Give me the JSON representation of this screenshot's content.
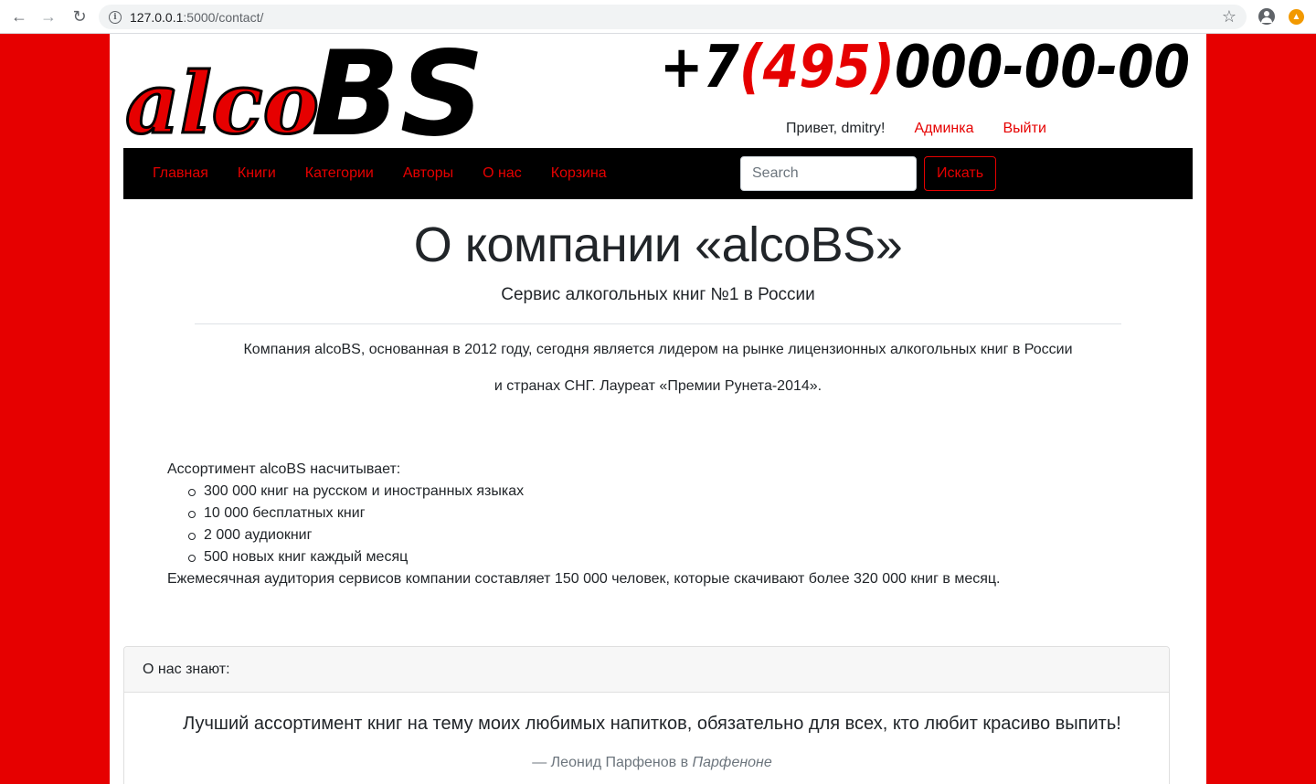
{
  "browser": {
    "url_host": "127.0.0.1",
    "url_path": ":5000/contact/"
  },
  "header": {
    "logo_left": "alco",
    "logo_right": "BS",
    "phone_prefix": "+7",
    "phone_code": "(495)",
    "phone_number": "000-00-00",
    "greeting": "Привет, dmitry!",
    "admin_link": "Админка",
    "logout_link": "Выйти"
  },
  "nav": {
    "items": [
      {
        "label": "Главная"
      },
      {
        "label": "Книги"
      },
      {
        "label": "Категории"
      },
      {
        "label": "Авторы"
      },
      {
        "label": "О нас"
      },
      {
        "label": "Корзина"
      }
    ],
    "search_placeholder": "Search",
    "search_button": "Искать"
  },
  "main": {
    "title": "О компании «alcoBS»",
    "subtitle": "Сервис алкогольных книг №1 в России",
    "intro_line1": "Компания alcoBS, основанная в 2012 году, сегодня является лидером на рынке лицензионных алкогольных книг в России",
    "intro_line2": "и странах СНГ. Лауреат «Премии Рунета-2014».",
    "assortment_heading": "Ассортимент alcoBS насчитывает:",
    "assortment_items": [
      "300 000 книг на русском и иностранных языках",
      "10 000 бесплатных книг",
      "2 000 аудиокниг",
      "500 новых книг каждый месяц"
    ],
    "audience_text": "Ежемесячная аудитория сервисов компании составляет 150 000 человек, которые скачивают более 320 000 книг в месяц."
  },
  "testimonial": {
    "header": "О нас знают:",
    "quote": "Лучший ассортимент книг на тему моих любимых напитков, обязательно для всех, кто любит красиво выпить!",
    "author": "— Леонид Парфенов в ",
    "source": "Парфеноне"
  },
  "colors": {
    "brand_red": "#e60000",
    "navbar_bg": "#000000"
  }
}
